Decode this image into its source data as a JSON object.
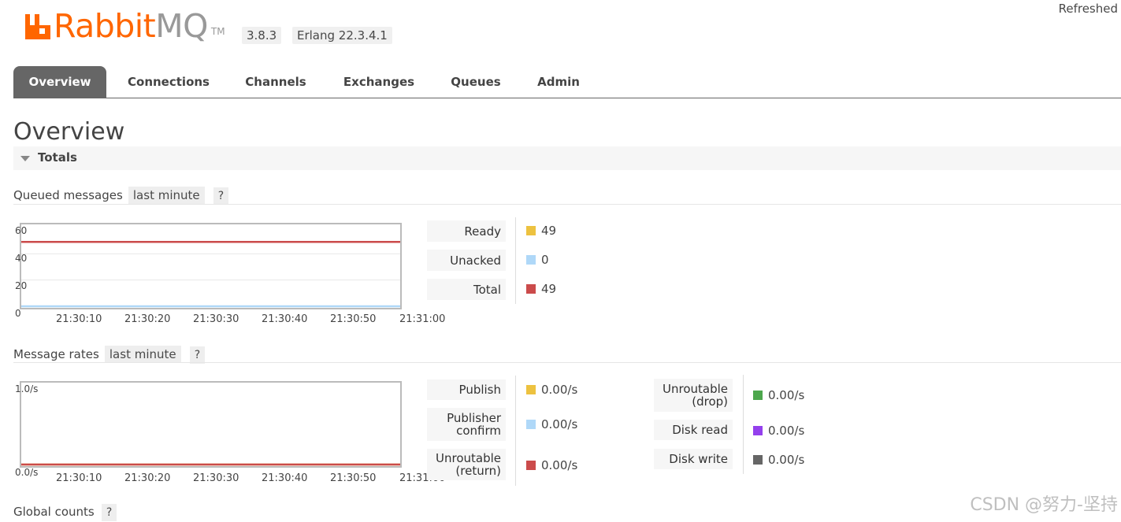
{
  "header": {
    "logo_rabbit": "Rabbit",
    "logo_mq": "MQ",
    "logo_tm": "TM",
    "version": "3.8.3",
    "erlang": "Erlang 22.3.4.1",
    "refreshed": "Refreshed"
  },
  "tabs": [
    {
      "label": "Overview",
      "active": true
    },
    {
      "label": "Connections",
      "active": false
    },
    {
      "label": "Channels",
      "active": false
    },
    {
      "label": "Exchanges",
      "active": false
    },
    {
      "label": "Queues",
      "active": false
    },
    {
      "label": "Admin",
      "active": false
    }
  ],
  "page_title": "Overview",
  "totals_label": "Totals",
  "queued": {
    "label": "Queued messages",
    "range": "last minute",
    "help": "?",
    "y_ticks": [
      "60",
      "40",
      "20",
      "0"
    ],
    "x_ticks": [
      "21:30:10",
      "21:30:20",
      "21:30:30",
      "21:30:40",
      "21:30:50",
      "21:31:00"
    ],
    "legend": [
      {
        "label": "Ready",
        "value": "49",
        "color": "#edc240"
      },
      {
        "label": "Unacked",
        "value": "0",
        "color": "#afd8f8"
      },
      {
        "label": "Total",
        "value": "49",
        "color": "#cb4b4b"
      }
    ]
  },
  "rates": {
    "label": "Message rates",
    "range": "last minute",
    "help": "?",
    "y_top": "1.0/s",
    "y_bottom": "0.0/s",
    "x_ticks": [
      "21:30:10",
      "21:30:20",
      "21:30:30",
      "21:30:40",
      "21:30:50",
      "21:31:00"
    ],
    "legend_left": [
      {
        "label1": "Publish",
        "label2": "",
        "value": "0.00/s",
        "color": "#edc240"
      },
      {
        "label1": "Publisher",
        "label2": "confirm",
        "value": "0.00/s",
        "color": "#afd8f8"
      },
      {
        "label1": "Unroutable",
        "label2": "(return)",
        "value": "0.00/s",
        "color": "#cb4b4b"
      }
    ],
    "legend_right": [
      {
        "label1": "Unroutable",
        "label2": "(drop)",
        "value": "0.00/s",
        "color": "#4da74d"
      },
      {
        "label1": "Disk read",
        "label2": "",
        "value": "0.00/s",
        "color": "#9440ed"
      },
      {
        "label1": "Disk write",
        "label2": "",
        "value": "0.00/s",
        "color": "#666666"
      }
    ]
  },
  "global": {
    "label": "Global counts",
    "help": "?"
  },
  "watermark": "CSDN @努力-坚持",
  "chart_data": [
    {
      "type": "line",
      "x": [
        "21:30:10",
        "21:30:20",
        "21:30:30",
        "21:30:40",
        "21:30:50",
        "21:31:00"
      ],
      "ylim": [
        0,
        60
      ],
      "series": [
        {
          "name": "Ready",
          "values": [
            49,
            49,
            49,
            49,
            49,
            49
          ]
        },
        {
          "name": "Unacked",
          "values": [
            0,
            0,
            0,
            0,
            0,
            0
          ]
        },
        {
          "name": "Total",
          "values": [
            49,
            49,
            49,
            49,
            49,
            49
          ]
        }
      ]
    },
    {
      "type": "line",
      "x": [
        "21:30:10",
        "21:30:20",
        "21:30:30",
        "21:30:40",
        "21:30:50",
        "21:31:00"
      ],
      "ylim": [
        0,
        1
      ],
      "series": [
        {
          "name": "Publish",
          "values": [
            0,
            0,
            0,
            0,
            0,
            0
          ]
        },
        {
          "name": "Unroutable (return)",
          "values": [
            0,
            0,
            0,
            0,
            0,
            0
          ]
        }
      ]
    }
  ]
}
